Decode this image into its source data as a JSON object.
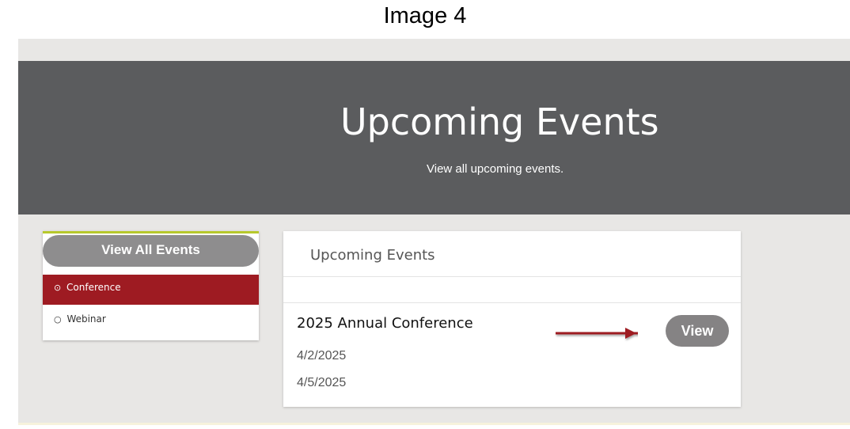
{
  "caption": "Image 4",
  "hero": {
    "title": "Upcoming Events",
    "subtitle": "View all upcoming events."
  },
  "sidebar": {
    "view_all_label": "View All Events",
    "categories": [
      {
        "label": "Conference",
        "selected": true
      },
      {
        "label": "Webinar",
        "selected": false
      }
    ]
  },
  "panel": {
    "title": "Upcoming Events",
    "events": [
      {
        "name": "2025 Annual Conference",
        "start_date": "4/2/2025",
        "end_date": "4/5/2025",
        "view_label": "View"
      }
    ]
  },
  "colors": {
    "hero_bg": "#5b5c5e",
    "accent_red": "#9e1b22",
    "accent_green": "#b7c82c",
    "button_gray": "#8e8d8e",
    "arrow_red": "#9e1b22"
  },
  "icons": {
    "selected_radio": "radio-selected-icon",
    "unselected_radio": "radio-unselected-icon",
    "annotation_arrow": "arrow-right-icon"
  }
}
